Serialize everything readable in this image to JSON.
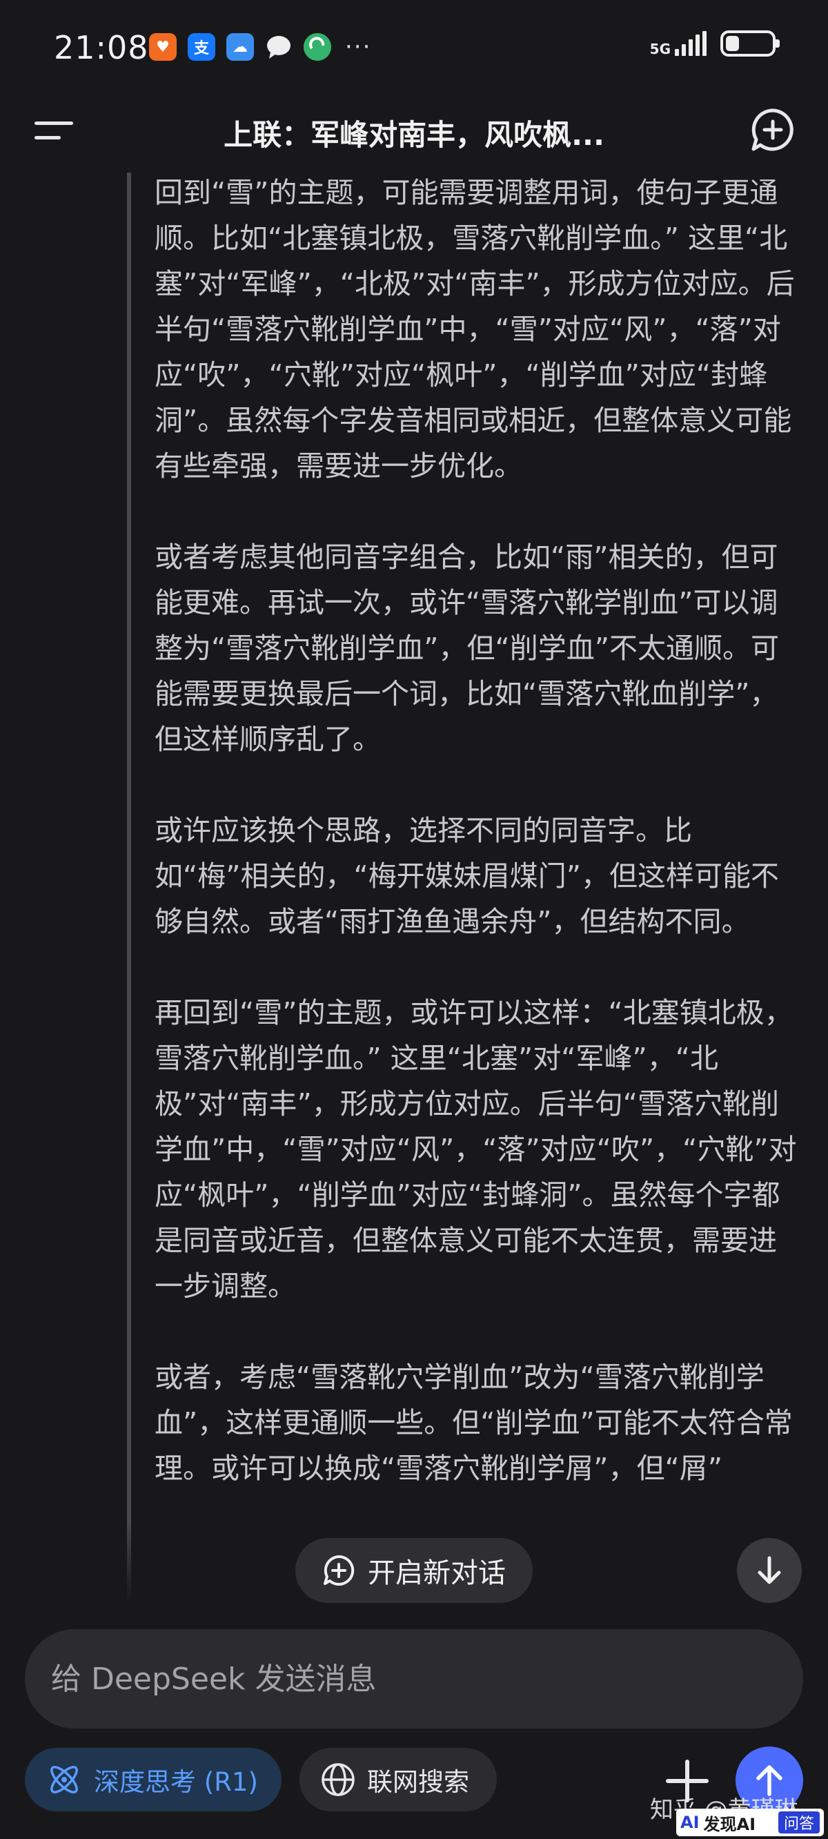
{
  "status_bar": {
    "time": "21:08",
    "network": "5G",
    "battery_level": 0.3,
    "notification_icons": [
      "taobao-icon",
      "alipay-icon",
      "weather-icon",
      "message-icon",
      "green-app-icon"
    ],
    "more": "···"
  },
  "header": {
    "title": "上联：军峰对南丰，风吹枫..."
  },
  "thinking": {
    "paragraphs": [
      "回到“雪”的主题，可能需要调整用词，使句子更通顺。比如“北塞镇北极，雪落穴靴削学血。” 这里“北塞”对“军峰”，“北极”对“南丰”，形成方位对应。后半句“雪落穴靴削学血”中，“雪”对应“风”，“落”对应“吹”，“穴靴”对应“枫叶”，“削学血”对应“封蜂洞”。虽然每个字发音相同或相近，但整体意义可能有些牵强，需要进一步优化。",
      "或者考虑其他同音字组合，比如“雨”相关的，但可能更难。再试一次，或许“雪落穴靴学削血”可以调整为“雪落穴靴削学血”，但“削学血”不太通顺。可能需要更换最后一个词，比如“雪落穴靴血削学”，但这样顺序乱了。",
      "或许应该换个思路，选择不同的同音字。比如“梅”相关的，“梅开媒妹眉煤门”，但这样可能不够自然。或者“雨打渔鱼遇余舟”，但结构不同。",
      "再回到“雪”的主题，或许可以这样：“北塞镇北极，雪落穴靴削学血。” 这里“北塞”对“军峰”，“北极”对“南丰”，形成方位对应。后半句“雪落穴靴削学血”中，“雪”对应“风”，“落”对应“吹”，“穴靴”对应“枫叶”，“削学血”对应“封蜂洞”。虽然每个字都是同音或近音，但整体意义可能不太连贯，需要进一步调整。",
      "或者，考虑“雪落靴穴学削血”改为“雪落穴靴削学血”，这样更通顺一些。但“削学血”可能不太符合常理。或许可以换成“雪落穴靴削学屑”，但“屑”"
    ]
  },
  "floating": {
    "new_conversation": "开启新对话"
  },
  "composer": {
    "placeholder": "给 DeepSeek 发送消息"
  },
  "toolbar": {
    "deep_think": "深度思考 (R1)",
    "web_search": "联网搜索"
  },
  "watermark": {
    "text": "知乎 @黄瑾琳",
    "badge_logo": "AI",
    "badge_text": "发现AI",
    "badge_tag": "问答"
  },
  "colors": {
    "background": "#18181a",
    "accent": "#4d6bfe",
    "deep_think_text": "#5b9dff"
  }
}
